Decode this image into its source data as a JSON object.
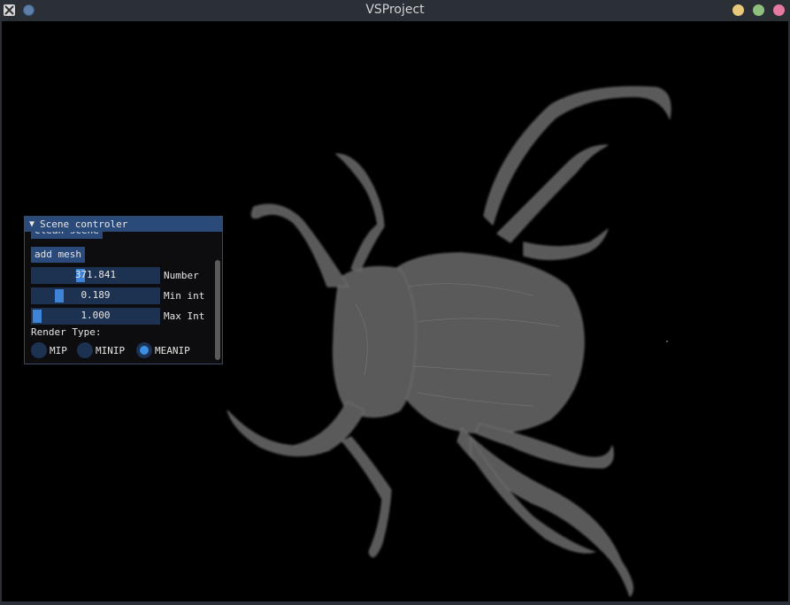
{
  "window": {
    "title": "VSProject"
  },
  "panel": {
    "header": "Scene controler",
    "clean_button": "clean scene",
    "add_button": "add mesh",
    "sliders": [
      {
        "value_text": "371.841",
        "label": "Number",
        "fraction": 0.42
      },
      {
        "value_text": "0.189",
        "label": "Min int",
        "fraction": 0.19
      },
      {
        "value_text": "1.000",
        "label": "Max Int",
        "fraction": 0.0
      }
    ],
    "render_type_label": "Render Type:",
    "radios": [
      {
        "label": "MIP",
        "selected": false
      },
      {
        "label": "MINIP",
        "selected": false
      },
      {
        "label": "MEANIP",
        "selected": true
      }
    ]
  },
  "colors": {
    "accent": "#3d84d6",
    "panel_header": "#2a4a7a",
    "widget_bg": "#1d3150",
    "viewport_bg": "#000000",
    "render_gray": "#6a6a6a"
  },
  "icons": [
    "app-icon",
    "window-menu-icon",
    "minimize-icon",
    "maximize-icon",
    "close-icon",
    "collapse-triangle-icon"
  ]
}
